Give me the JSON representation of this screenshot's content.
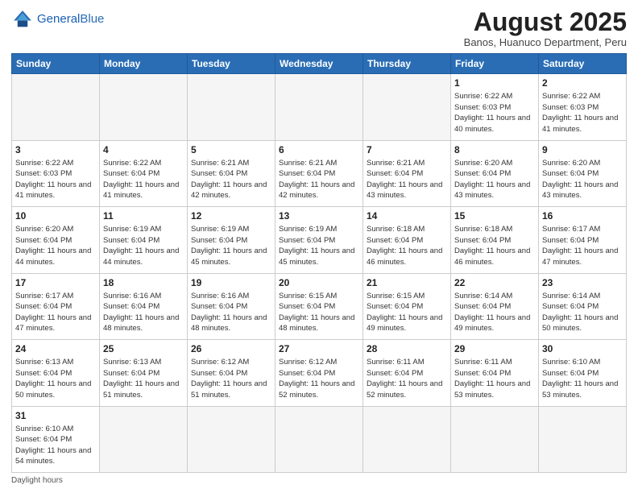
{
  "header": {
    "logo_general": "General",
    "logo_blue": "Blue",
    "title": "August 2025",
    "location": "Banos, Huanuco Department, Peru"
  },
  "weekdays": [
    "Sunday",
    "Monday",
    "Tuesday",
    "Wednesday",
    "Thursday",
    "Friday",
    "Saturday"
  ],
  "footer": {
    "note": "Daylight hours"
  },
  "days": {
    "1": {
      "sunrise": "6:22 AM",
      "sunset": "6:03 PM",
      "daylight": "11 hours and 40 minutes."
    },
    "2": {
      "sunrise": "6:22 AM",
      "sunset": "6:03 PM",
      "daylight": "11 hours and 41 minutes."
    },
    "3": {
      "sunrise": "6:22 AM",
      "sunset": "6:03 PM",
      "daylight": "11 hours and 41 minutes."
    },
    "4": {
      "sunrise": "6:22 AM",
      "sunset": "6:04 PM",
      "daylight": "11 hours and 41 minutes."
    },
    "5": {
      "sunrise": "6:21 AM",
      "sunset": "6:04 PM",
      "daylight": "11 hours and 42 minutes."
    },
    "6": {
      "sunrise": "6:21 AM",
      "sunset": "6:04 PM",
      "daylight": "11 hours and 42 minutes."
    },
    "7": {
      "sunrise": "6:21 AM",
      "sunset": "6:04 PM",
      "daylight": "11 hours and 43 minutes."
    },
    "8": {
      "sunrise": "6:20 AM",
      "sunset": "6:04 PM",
      "daylight": "11 hours and 43 minutes."
    },
    "9": {
      "sunrise": "6:20 AM",
      "sunset": "6:04 PM",
      "daylight": "11 hours and 43 minutes."
    },
    "10": {
      "sunrise": "6:20 AM",
      "sunset": "6:04 PM",
      "daylight": "11 hours and 44 minutes."
    },
    "11": {
      "sunrise": "6:19 AM",
      "sunset": "6:04 PM",
      "daylight": "11 hours and 44 minutes."
    },
    "12": {
      "sunrise": "6:19 AM",
      "sunset": "6:04 PM",
      "daylight": "11 hours and 45 minutes."
    },
    "13": {
      "sunrise": "6:19 AM",
      "sunset": "6:04 PM",
      "daylight": "11 hours and 45 minutes."
    },
    "14": {
      "sunrise": "6:18 AM",
      "sunset": "6:04 PM",
      "daylight": "11 hours and 46 minutes."
    },
    "15": {
      "sunrise": "6:18 AM",
      "sunset": "6:04 PM",
      "daylight": "11 hours and 46 minutes."
    },
    "16": {
      "sunrise": "6:17 AM",
      "sunset": "6:04 PM",
      "daylight": "11 hours and 47 minutes."
    },
    "17": {
      "sunrise": "6:17 AM",
      "sunset": "6:04 PM",
      "daylight": "11 hours and 47 minutes."
    },
    "18": {
      "sunrise": "6:16 AM",
      "sunset": "6:04 PM",
      "daylight": "11 hours and 48 minutes."
    },
    "19": {
      "sunrise": "6:16 AM",
      "sunset": "6:04 PM",
      "daylight": "11 hours and 48 minutes."
    },
    "20": {
      "sunrise": "6:15 AM",
      "sunset": "6:04 PM",
      "daylight": "11 hours and 48 minutes."
    },
    "21": {
      "sunrise": "6:15 AM",
      "sunset": "6:04 PM",
      "daylight": "11 hours and 49 minutes."
    },
    "22": {
      "sunrise": "6:14 AM",
      "sunset": "6:04 PM",
      "daylight": "11 hours and 49 minutes."
    },
    "23": {
      "sunrise": "6:14 AM",
      "sunset": "6:04 PM",
      "daylight": "11 hours and 50 minutes."
    },
    "24": {
      "sunrise": "6:13 AM",
      "sunset": "6:04 PM",
      "daylight": "11 hours and 50 minutes."
    },
    "25": {
      "sunrise": "6:13 AM",
      "sunset": "6:04 PM",
      "daylight": "11 hours and 51 minutes."
    },
    "26": {
      "sunrise": "6:12 AM",
      "sunset": "6:04 PM",
      "daylight": "11 hours and 51 minutes."
    },
    "27": {
      "sunrise": "6:12 AM",
      "sunset": "6:04 PM",
      "daylight": "11 hours and 52 minutes."
    },
    "28": {
      "sunrise": "6:11 AM",
      "sunset": "6:04 PM",
      "daylight": "11 hours and 52 minutes."
    },
    "29": {
      "sunrise": "6:11 AM",
      "sunset": "6:04 PM",
      "daylight": "11 hours and 53 minutes."
    },
    "30": {
      "sunrise": "6:10 AM",
      "sunset": "6:04 PM",
      "daylight": "11 hours and 53 minutes."
    },
    "31": {
      "sunrise": "6:10 AM",
      "sunset": "6:04 PM",
      "daylight": "11 hours and 54 minutes."
    }
  }
}
